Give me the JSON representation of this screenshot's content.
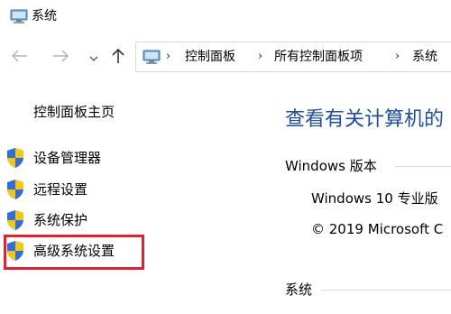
{
  "window": {
    "title": "系统"
  },
  "navigation": {
    "back_icon": "arrow-left-icon",
    "forward_icon": "arrow-right-icon",
    "recent_icon": "chevron-down-icon",
    "up_icon": "arrow-up-icon"
  },
  "address_bar": {
    "breadcrumbs": [
      "控制面板",
      "所有控制面板项",
      "系统"
    ],
    "separator": "›"
  },
  "sidebar": {
    "home": "控制面板主页",
    "links": [
      {
        "label": "设备管理器",
        "icon": "uac-shield-icon"
      },
      {
        "label": "远程设置",
        "icon": "uac-shield-icon"
      },
      {
        "label": "系统保护",
        "icon": "uac-shield-icon"
      },
      {
        "label": "高级系统设置",
        "icon": "uac-shield-icon"
      }
    ]
  },
  "main": {
    "title": "查看有关计算机的",
    "windows_edition": {
      "heading": "Windows 版本",
      "edition": "Windows 10 专业版",
      "copyright": "© 2019 Microsoft C"
    },
    "system": {
      "heading": "系统"
    }
  },
  "colors": {
    "title_blue": "#1e4e9c",
    "highlight_red": "#e0212f",
    "shield_blue": "#2d6fd6",
    "shield_yellow": "#f5c518"
  }
}
